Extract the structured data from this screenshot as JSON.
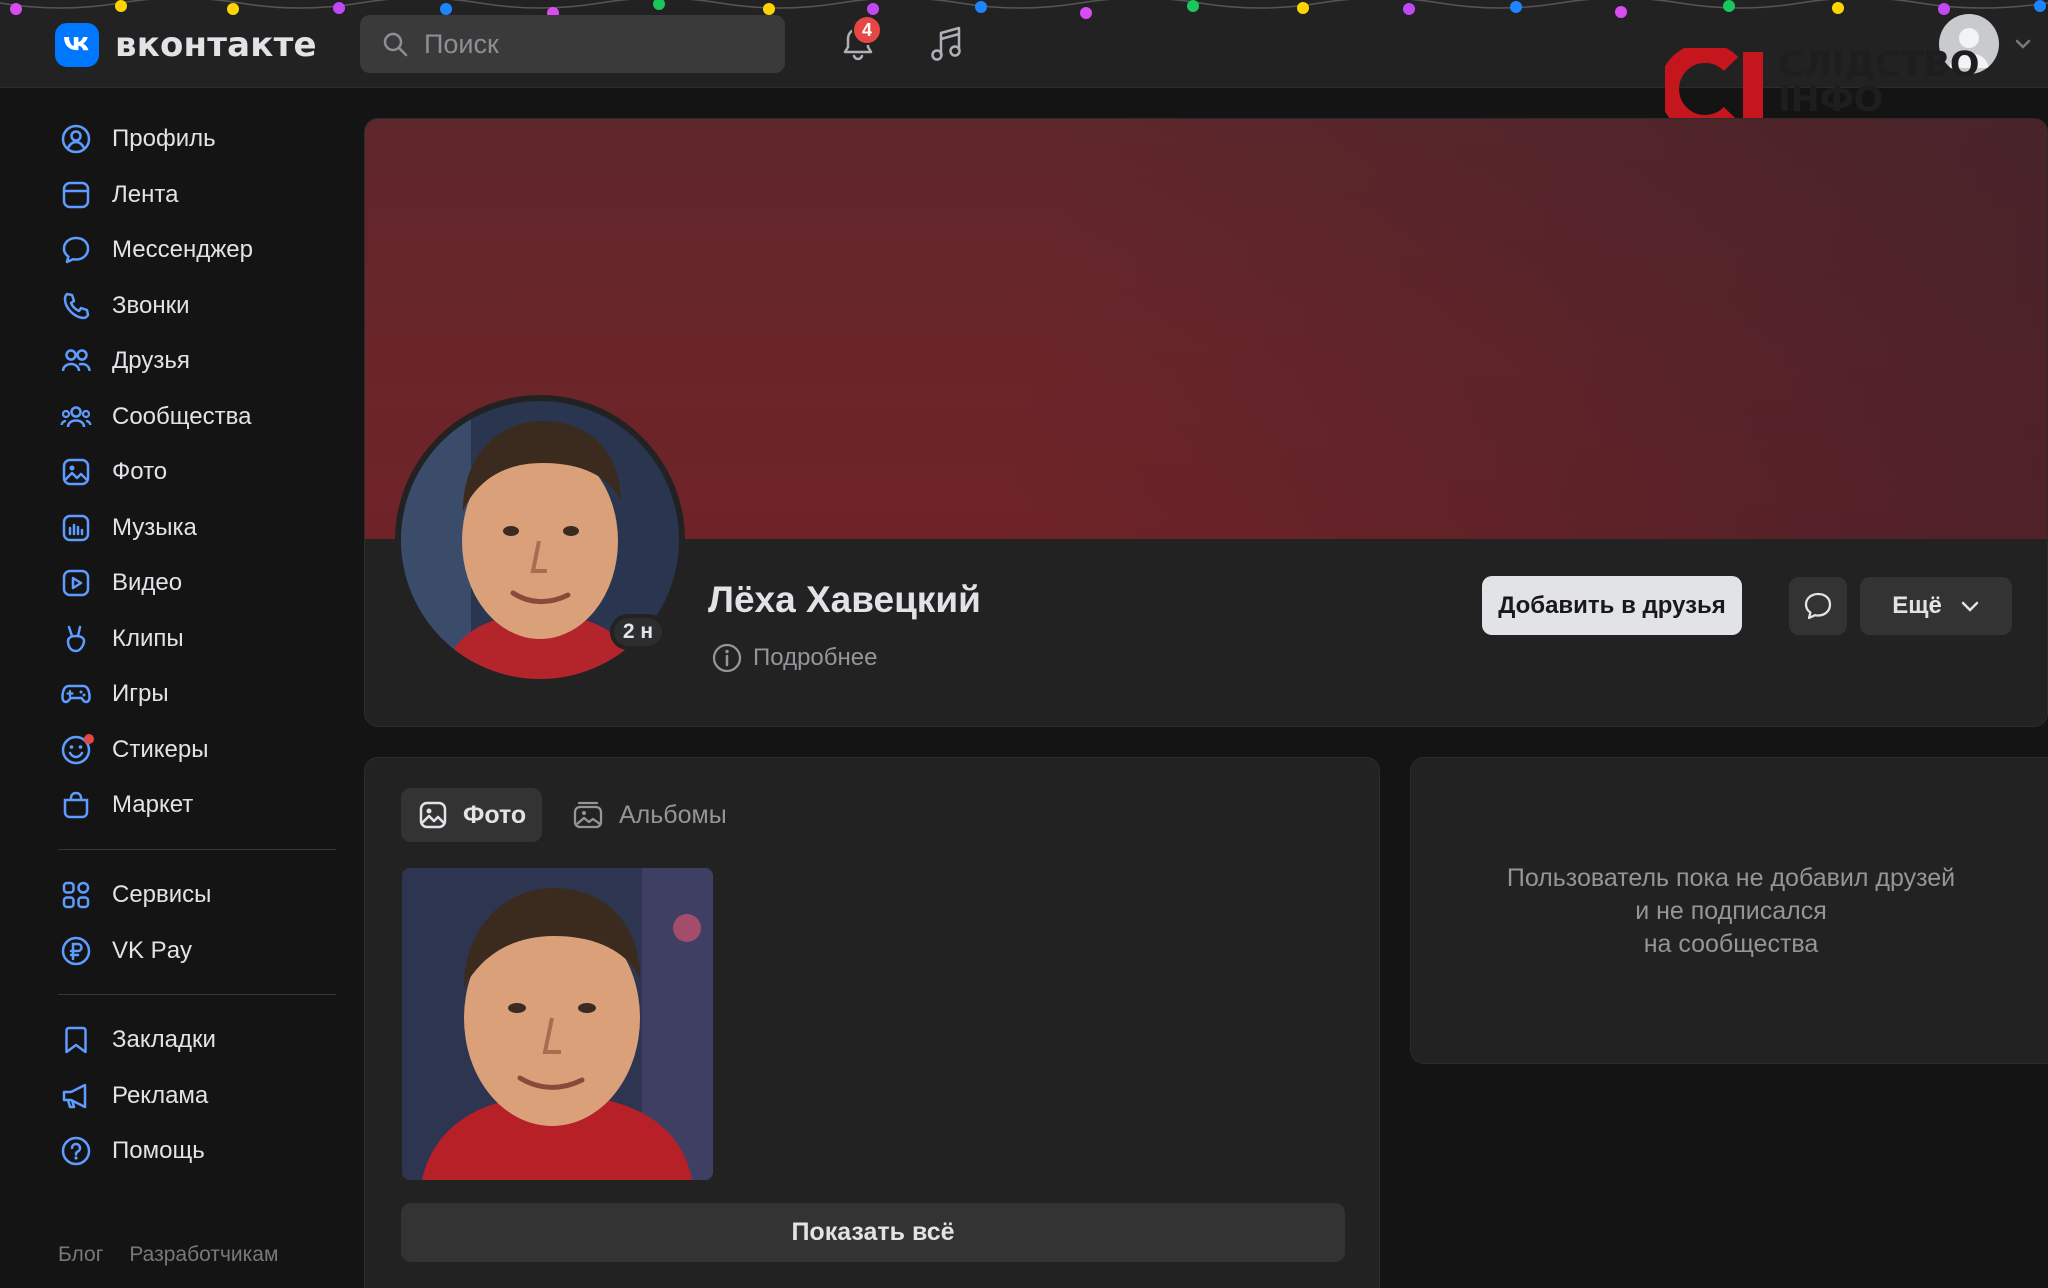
{
  "header": {
    "logo_text": "вконтакте",
    "search_placeholder": "Поиск",
    "notifications_count": "4",
    "watermark": {
      "line1": "СЛІДСТВО",
      "line2": "ІНФО"
    }
  },
  "sidebar": {
    "main_items": [
      {
        "label": "Профиль",
        "icon": "profile-icon"
      },
      {
        "label": "Лента",
        "icon": "feed-icon"
      },
      {
        "label": "Мессенджер",
        "icon": "messenger-icon"
      },
      {
        "label": "Звонки",
        "icon": "phone-icon"
      },
      {
        "label": "Друзья",
        "icon": "friends-icon"
      },
      {
        "label": "Сообщества",
        "icon": "communities-icon"
      },
      {
        "label": "Фото",
        "icon": "photo-icon"
      },
      {
        "label": "Музыка",
        "icon": "music-icon"
      },
      {
        "label": "Видео",
        "icon": "video-icon"
      },
      {
        "label": "Клипы",
        "icon": "clips-icon"
      },
      {
        "label": "Игры",
        "icon": "gamepad-icon"
      },
      {
        "label": "Стикеры",
        "icon": "stickers-icon"
      },
      {
        "label": "Маркет",
        "icon": "market-bag-icon"
      }
    ],
    "service_items": [
      {
        "label": "Сервисы",
        "icon": "services-grid-icon"
      },
      {
        "label": "VK Pay",
        "icon": "vkpay-ruble-icon"
      }
    ],
    "extra_items": [
      {
        "label": "Закладки",
        "icon": "bookmark-icon"
      },
      {
        "label": "Реклама",
        "icon": "megaphone-icon"
      },
      {
        "label": "Помощь",
        "icon": "help-icon"
      }
    ],
    "footer_links": [
      "Блог",
      "Разработчикам"
    ]
  },
  "profile": {
    "name": "Лёха Хавецкий",
    "last_seen": "2 н",
    "details_label": "Подробнее",
    "add_friend_label": "Добавить в друзья",
    "more_label": "Ещё"
  },
  "photos": {
    "tab_photos": "Фото",
    "tab_albums": "Альбомы",
    "show_all_label": "Показать всё"
  },
  "friends_placeholder": {
    "line1": "Пользователь пока не добавил друзей",
    "line2": "и не подписался",
    "line3": "на сообщества"
  },
  "colors": {
    "background": "#141414",
    "panel": "#222222",
    "accent": "#0077ff",
    "badge": "#e64646",
    "cover": "#6b2529"
  }
}
